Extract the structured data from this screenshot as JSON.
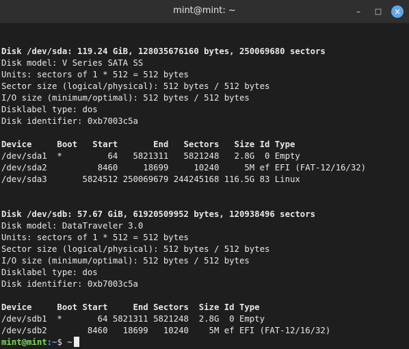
{
  "window": {
    "title": "mint@mint: ~",
    "controls": {
      "minimize": "–",
      "maximize": "□",
      "close": "×"
    }
  },
  "terminal": {
    "lines": [
      "",
      "Disk /dev/sda: 119.24 GiB, 128035676160 bytes, 250069680 sectors",
      "Disk model: V Series SATA SS",
      "Units: sectors of 1 * 512 = 512 bytes",
      "Sector size (logical/physical): 512 bytes / 512 bytes",
      "I/O size (minimum/optimal): 512 bytes / 512 bytes",
      "Disklabel type: dos",
      "Disk identifier: 0xb7003c5a",
      "",
      "Device     Boot   Start       End   Sectors   Size Id Type",
      "/dev/sda1  *         64   5821311   5821248   2.8G  0 Empty",
      "/dev/sda2          8460     18699     10240     5M ef EFI (FAT-12/16/32)",
      "/dev/sda3       5824512 250069679 244245168 116.5G 83 Linux",
      "",
      "",
      "Disk /dev/sdb: 57.67 GiB, 61920509952 bytes, 120938496 sectors",
      "Disk model: DataTraveler 3.0",
      "Units: sectors of 1 * 512 = 512 bytes",
      "Sector size (logical/physical): 512 bytes / 512 bytes",
      "I/O size (minimum/optimal): 512 bytes / 512 bytes",
      "Disklabel type: dos",
      "Disk identifier: 0xb7003c5a",
      "",
      "Device     Boot Start     End Sectors  Size Id Type",
      "/dev/sdb1  *       64 5821311 5821248  2.8G  0 Empty",
      "/dev/sdb2        8460   18699   10240    5M ef EFI (FAT-12/16/32)"
    ],
    "prompt": {
      "user_host": "mint@mint",
      "path": ":~",
      "symbol": "$ ",
      "input": "~"
    }
  }
}
